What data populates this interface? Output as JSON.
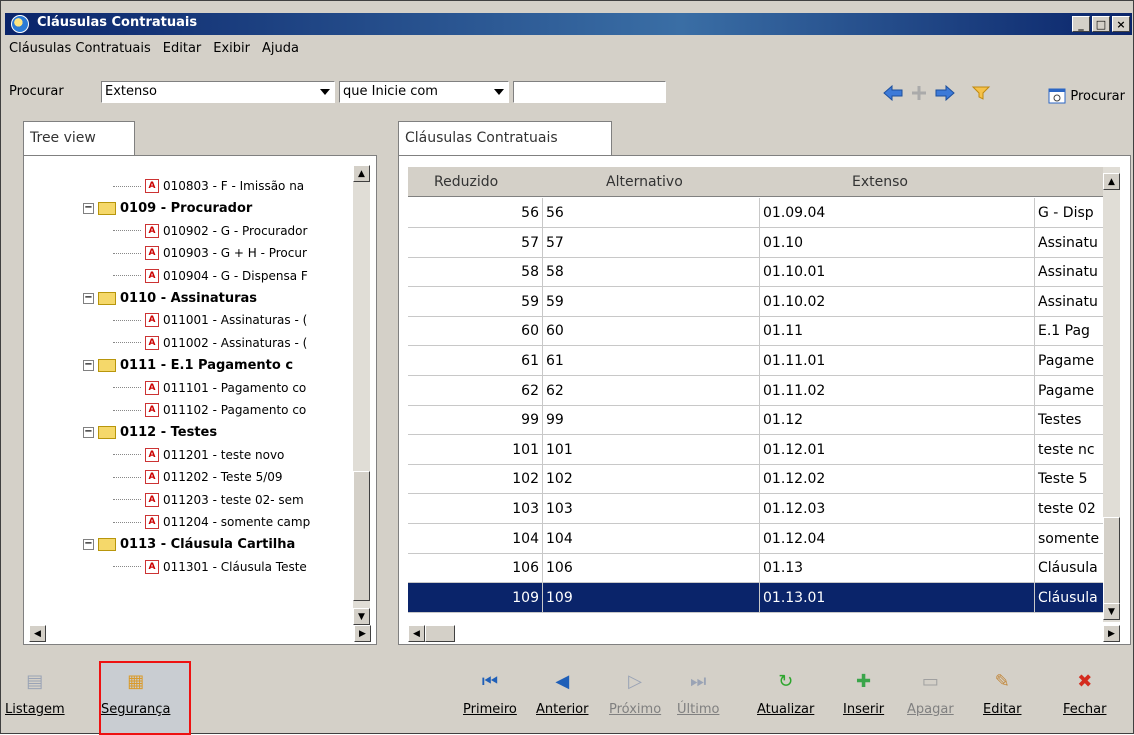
{
  "window": {
    "title": "Cláusulas Contratuais"
  },
  "menu": [
    "Cláusulas Contratuais",
    "Editar",
    "Exibir",
    "Ajuda"
  ],
  "search": {
    "label": "Procurar",
    "field_value": "Extenso",
    "mode_value": "que Inicie com",
    "text_value": "",
    "button_label": "Procurar"
  },
  "tree_tab": {
    "label": "Tree view"
  },
  "grid_tab": {
    "label": "Cláusulas Contratuais"
  },
  "tree": [
    {
      "type": "leaf",
      "text": "010803 - F - Imissão na"
    },
    {
      "type": "folder",
      "text": "0109 - Procurador"
    },
    {
      "type": "leaf",
      "text": "010902 - G - Procurador"
    },
    {
      "type": "leaf",
      "text": "010903 - G + H - Procur"
    },
    {
      "type": "leaf",
      "text": "010904 - G - Dispensa F"
    },
    {
      "type": "folder",
      "text": "0110 - Assinaturas"
    },
    {
      "type": "leaf",
      "text": "011001 - Assinaturas - ("
    },
    {
      "type": "leaf",
      "text": "011002 - Assinaturas - ("
    },
    {
      "type": "folder",
      "text": "0111 - E.1 Pagamento c"
    },
    {
      "type": "leaf",
      "text": "011101 - Pagamento co"
    },
    {
      "type": "leaf",
      "text": "011102 - Pagamento co"
    },
    {
      "type": "folder",
      "text": "0112 - Testes"
    },
    {
      "type": "leaf",
      "text": "011201 - teste novo"
    },
    {
      "type": "leaf",
      "text": "011202 - Teste 5/09"
    },
    {
      "type": "leaf",
      "text": "011203 - teste 02- sem"
    },
    {
      "type": "leaf",
      "text": "011204 - somente camp"
    },
    {
      "type": "folder",
      "text": "0113 - Cláusula Cartilha"
    },
    {
      "type": "leaf",
      "text": "011301 - Cláusula Teste"
    }
  ],
  "grid": {
    "columns": [
      "Reduzido",
      "Alternativo",
      "Extenso"
    ],
    "rows": [
      [
        "56",
        "56",
        "01.09.04",
        "G - Disp"
      ],
      [
        "57",
        "57",
        "01.10",
        "Assinatu"
      ],
      [
        "58",
        "58",
        "01.10.01",
        "Assinatu"
      ],
      [
        "59",
        "59",
        "01.10.02",
        "Assinatu"
      ],
      [
        "60",
        "60",
        "01.11",
        "E.1 Pag"
      ],
      [
        "61",
        "61",
        "01.11.01",
        "Pagame"
      ],
      [
        "62",
        "62",
        "01.11.02",
        "Pagame"
      ],
      [
        "99",
        "99",
        "01.12",
        "Testes"
      ],
      [
        "101",
        "101",
        "01.12.01",
        "teste nc"
      ],
      [
        "102",
        "102",
        "01.12.02",
        "Teste 5"
      ],
      [
        "103",
        "103",
        "01.12.03",
        "teste 02"
      ],
      [
        "104",
        "104",
        "01.12.04",
        "somente"
      ],
      [
        "106",
        "106",
        "01.13",
        "Cláusula"
      ],
      [
        "109",
        "109",
        "01.13.01",
        "Cláusula"
      ]
    ],
    "selected_row": 13
  },
  "toolbar": [
    {
      "name": "listagem-button",
      "label": "Listagem",
      "icon": "document-icon",
      "disabled": false
    },
    {
      "name": "seguranca-button",
      "label": "Segurança",
      "icon": "lock-document-icon",
      "disabled": false
    },
    {
      "name": "primeiro-button",
      "label": "Primeiro",
      "icon": "first-icon",
      "disabled": false
    },
    {
      "name": "anterior-button",
      "label": "Anterior",
      "icon": "previous-icon",
      "disabled": false
    },
    {
      "name": "proximo-button",
      "label": "Próximo",
      "icon": "next-icon",
      "disabled": true
    },
    {
      "name": "ultimo-button",
      "label": "Último",
      "icon": "last-icon",
      "disabled": true
    },
    {
      "name": "atualizar-button",
      "label": "Atualizar",
      "icon": "refresh-icon",
      "disabled": false
    },
    {
      "name": "inserir-button",
      "label": "Inserir",
      "icon": "insert-icon",
      "disabled": false
    },
    {
      "name": "apagar-button",
      "label": "Apagar",
      "icon": "delete-icon",
      "disabled": true
    },
    {
      "name": "editar-button",
      "label": "Editar",
      "icon": "edit-icon",
      "disabled": false
    },
    {
      "name": "fechar-button",
      "label": "Fechar",
      "icon": "close-icon",
      "disabled": false
    }
  ],
  "colors": {
    "title_bar": "#0a246a",
    "selection": "#0a246a",
    "highlight_border": "#e11111",
    "window_bg": "#d4d0c8"
  }
}
